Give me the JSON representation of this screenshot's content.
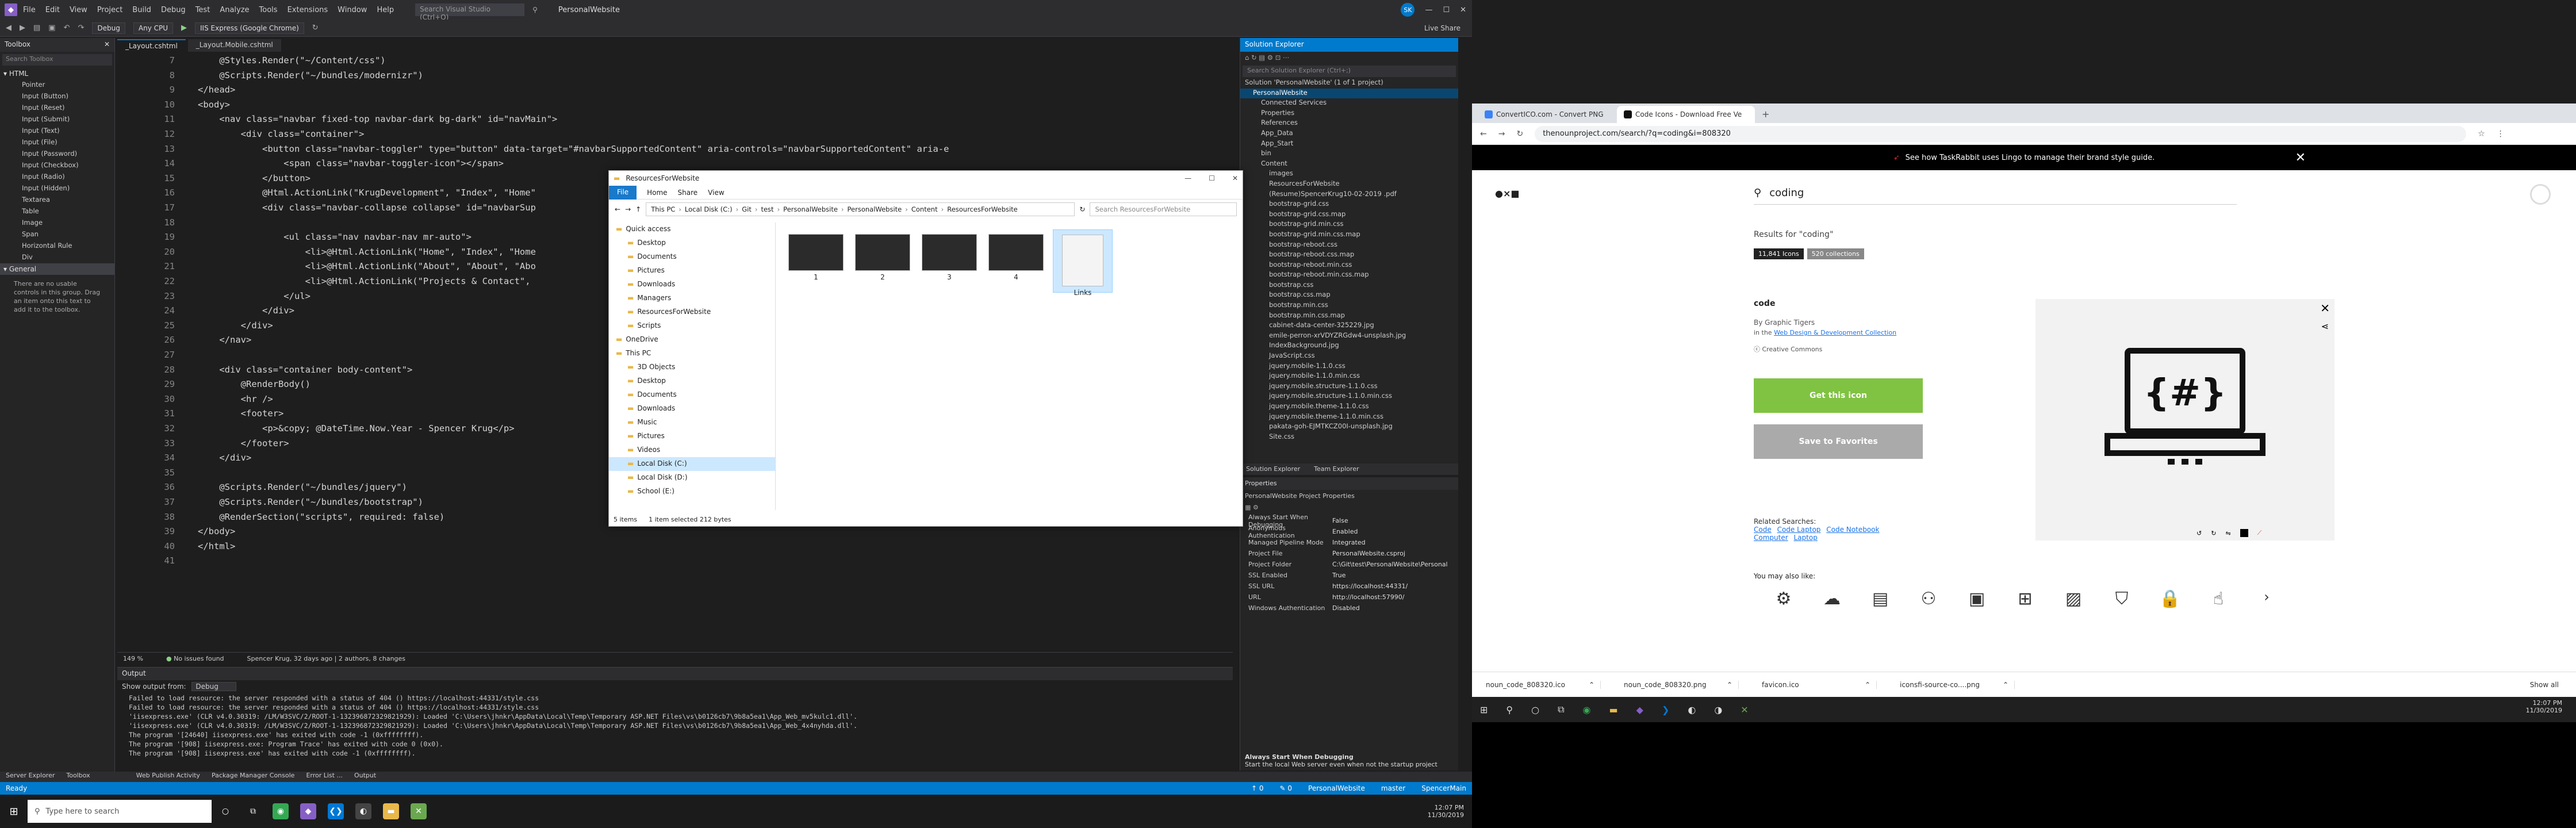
{
  "vs": {
    "menu": [
      "File",
      "Edit",
      "View",
      "Project",
      "Build",
      "Debug",
      "Test",
      "Analyze",
      "Tools",
      "Extensions",
      "Window",
      "Help"
    ],
    "search_placeholder": "Search Visual Studio (Ctrl+Q)",
    "project_name": "PersonalWebsite",
    "user_initials": "SK",
    "live_share": "Live Share",
    "toolbar": {
      "config": "Debug",
      "platform": "Any CPU",
      "run": "IIS Express (Google Chrome)"
    },
    "toolbox": {
      "title": "Toolbox",
      "search": "Search Toolbox",
      "html_group": "HTML",
      "items": [
        "Pointer",
        "Input (Button)",
        "Input (Reset)",
        "Input (Submit)",
        "Input (Text)",
        "Input (File)",
        "Input (Password)",
        "Input (Checkbox)",
        "Input (Radio)",
        "Input (Hidden)",
        "Textarea",
        "Table",
        "Image",
        "Span",
        "Horizontal Rule",
        "Div"
      ],
      "general_group": "General",
      "note": "There are no usable controls in this group. Drag an item onto this text to add it to the toolbox."
    },
    "tabs": [
      "_Layout.cshtml",
      "_Layout.Mobile.cshtml"
    ],
    "code_lines": [
      {
        "n": "7",
        "t": "    @Styles.Render(\"~/Content/css\")"
      },
      {
        "n": "8",
        "t": "    @Scripts.Render(\"~/bundles/modernizr\")"
      },
      {
        "n": "9",
        "t": "</head>"
      },
      {
        "n": "10",
        "t": "<body>"
      },
      {
        "n": "11",
        "t": "    <nav class=\"navbar fixed-top navbar-dark bg-dark\" id=\"navMain\">"
      },
      {
        "n": "12",
        "t": "        <div class=\"container\">"
      },
      {
        "n": "13",
        "t": "            <button class=\"navbar-toggler\" type=\"button\" data-target=\"#navbarSupportedContent\" aria-controls=\"navbarSupportedContent\" aria-e"
      },
      {
        "n": "14",
        "t": "                <span class=\"navbar-toggler-icon\"></span>"
      },
      {
        "n": "15",
        "t": "            </button>"
      },
      {
        "n": "16",
        "t": "            @Html.ActionLink(\"KrugDevelopment\", \"Index\", \"Home\""
      },
      {
        "n": "17",
        "t": "            <div class=\"navbar-collapse collapse\" id=\"navbarSup"
      },
      {
        "n": "18",
        "t": ""
      },
      {
        "n": "19",
        "t": "                <ul class=\"nav navbar-nav mr-auto\">"
      },
      {
        "n": "20",
        "t": "                    <li>@Html.ActionLink(\"Home\", \"Index\", \"Home"
      },
      {
        "n": "21",
        "t": "                    <li>@Html.ActionLink(\"About\", \"About\", \"Abo"
      },
      {
        "n": "22",
        "t": "                    <li>@Html.ActionLink(\"Projects & Contact\","
      },
      {
        "n": "23",
        "t": "                </ul>"
      },
      {
        "n": "24",
        "t": "            </div>"
      },
      {
        "n": "25",
        "t": "        </div>"
      },
      {
        "n": "26",
        "t": "    </nav>"
      },
      {
        "n": "27",
        "t": ""
      },
      {
        "n": "28",
        "t": "    <div class=\"container body-content\">"
      },
      {
        "n": "29",
        "t": "        @RenderBody()"
      },
      {
        "n": "30",
        "t": "        <hr />"
      },
      {
        "n": "31",
        "t": "        <footer>"
      },
      {
        "n": "32",
        "t": "            <p>&copy; @DateTime.Now.Year - Spencer Krug</p>"
      },
      {
        "n": "33",
        "t": "        </footer>"
      },
      {
        "n": "34",
        "t": "    </div>"
      },
      {
        "n": "35",
        "t": ""
      },
      {
        "n": "36",
        "t": "    @Scripts.Render(\"~/bundles/jquery\")"
      },
      {
        "n": "37",
        "t": "    @Scripts.Render(\"~/bundles/bootstrap\")"
      },
      {
        "n": "38",
        "t": "    @RenderSection(\"scripts\", required: false)"
      },
      {
        "n": "39",
        "t": "</body>"
      },
      {
        "n": "40",
        "t": "</html>"
      },
      {
        "n": "41",
        "t": ""
      }
    ],
    "zoom": "149 %",
    "issues": "No issues found",
    "git_info": "Spencer Krug, 32 days ago | 2 authors, 8 changes",
    "output": {
      "title": "Output",
      "show_from_label": "Show output from:",
      "show_from_value": "Debug",
      "lines": [
        "Failed to load resource: the server responded with a status of 404 () https://localhost:44331/style.css",
        "Failed to load resource: the server responded with a status of 404 () https://localhost:44331/style.css",
        "'iisexpress.exe' (CLR v4.0.30319: /LM/W3SVC/2/ROOT-1-132396872329821929): Loaded 'C:\\Users\\jhnkr\\AppData\\Local\\Temp\\Temporary ASP.NET Files\\vs\\b0126cb7\\9b8a5ea1\\App_Web_mv5kulc1.dll'.",
        "'iisexpress.exe' (CLR v4.0.30319: /LM/W3SVC/2/ROOT-1-132396872329821929): Loaded 'C:\\Users\\jhnkr\\AppData\\Local\\Temp\\Temporary ASP.NET Files\\vs\\b0126cb7\\9b8a5ea1\\App_Web_4x4nyhda.dll'.",
        "The program '[24640] iisexpress.exe' has exited with code -1 (0xffffffff).",
        "The program '[908] iisexpress.exe: Program Trace' has exited with code 0 (0x0).",
        "The program '[908] iisexpress.exe' has exited with code -1 (0xffffffff)."
      ]
    },
    "bottom_tabs": [
      "Web Publish Activity",
      "Package Manager Console",
      "Error List ...",
      "Output"
    ],
    "left_bottom_tabs": [
      "Server Explorer",
      "Toolbox"
    ],
    "status": {
      "left": "Ready",
      "items": [
        "↑ 0",
        "✎ 0",
        "PersonalWebsite",
        "master",
        "SpencerMain"
      ]
    },
    "solution": {
      "title": "Solution Explorer",
      "search": "Search Solution Explorer (Ctrl+;)",
      "nodes": [
        {
          "t": "Solution 'PersonalWebsite' (1 of 1 project)",
          "d": 0
        },
        {
          "t": "PersonalWebsite",
          "d": 1,
          "sel": true
        },
        {
          "t": "Connected Services",
          "d": 2
        },
        {
          "t": "Properties",
          "d": 2
        },
        {
          "t": "References",
          "d": 2
        },
        {
          "t": "App_Data",
          "d": 2
        },
        {
          "t": "App_Start",
          "d": 2
        },
        {
          "t": "bin",
          "d": 2
        },
        {
          "t": "Content",
          "d": 2
        },
        {
          "t": "images",
          "d": 3
        },
        {
          "t": "ResourcesForWebsite",
          "d": 3
        },
        {
          "t": "(Resume)SpencerKrug10-02-2019 .pdf",
          "d": 3
        },
        {
          "t": "bootstrap-grid.css",
          "d": 3
        },
        {
          "t": "bootstrap-grid.css.map",
          "d": 3
        },
        {
          "t": "bootstrap-grid.min.css",
          "d": 3
        },
        {
          "t": "bootstrap-grid.min.css.map",
          "d": 3
        },
        {
          "t": "bootstrap-reboot.css",
          "d": 3
        },
        {
          "t": "bootstrap-reboot.css.map",
          "d": 3
        },
        {
          "t": "bootstrap-reboot.min.css",
          "d": 3
        },
        {
          "t": "bootstrap-reboot.min.css.map",
          "d": 3
        },
        {
          "t": "bootstrap.css",
          "d": 3
        },
        {
          "t": "bootstrap.css.map",
          "d": 3
        },
        {
          "t": "bootstrap.min.css",
          "d": 3
        },
        {
          "t": "bootstrap.min.css.map",
          "d": 3
        },
        {
          "t": "cabinet-data-center-325229.jpg",
          "d": 3
        },
        {
          "t": "emile-perron-xrVDYZRGdw4-unsplash.jpg",
          "d": 3
        },
        {
          "t": "IndexBackground.jpg",
          "d": 3
        },
        {
          "t": "JavaScript.css",
          "d": 3
        },
        {
          "t": "jquery.mobile-1.1.0.css",
          "d": 3
        },
        {
          "t": "jquery.mobile-1.1.0.min.css",
          "d": 3
        },
        {
          "t": "jquery.mobile.structure-1.1.0.css",
          "d": 3
        },
        {
          "t": "jquery.mobile.structure-1.1.0.min.css",
          "d": 3
        },
        {
          "t": "jquery.mobile.theme-1.1.0.css",
          "d": 3
        },
        {
          "t": "jquery.mobile.theme-1.1.0.min.css",
          "d": 3
        },
        {
          "t": "pakata-goh-EJMTKCZ00I-unsplash.jpg",
          "d": 3
        },
        {
          "t": "Site.css",
          "d": 3
        }
      ],
      "bottom_tabs": [
        "Solution Explorer",
        "Team Explorer"
      ]
    },
    "properties": {
      "title": "Properties",
      "subtitle": "PersonalWebsite  Project Properties",
      "rows": [
        {
          "k": "Always Start When Debugging",
          "v": "False"
        },
        {
          "k": "Anonymous Authentication",
          "v": "Enabled"
        },
        {
          "k": "Managed Pipeline Mode",
          "v": "Integrated"
        },
        {
          "k": "Project File",
          "v": "PersonalWebsite.csproj"
        },
        {
          "k": "Project Folder",
          "v": "C:\\Git\\test\\PersonalWebsite\\Personal"
        },
        {
          "k": "SSL Enabled",
          "v": "True"
        },
        {
          "k": "SSL URL",
          "v": "https://localhost:44331/"
        },
        {
          "k": "URL",
          "v": "http://localhost:57990/"
        },
        {
          "k": "Windows Authentication",
          "v": "Disabled"
        }
      ],
      "desc_title": "Always Start When Debugging",
      "desc_text": "Start the local Web server even when not the startup project"
    }
  },
  "explorer": {
    "title": "ResourcesForWebsite",
    "ribbon": [
      "File",
      "Home",
      "Share",
      "View"
    ],
    "path": [
      "This PC",
      "Local Disk (C:)",
      "Git",
      "test",
      "PersonalWebsite",
      "PersonalWebsite",
      "Content",
      "ResourcesForWebsite"
    ],
    "search_placeholder": "Search ResourcesForWebsite",
    "nav": [
      {
        "t": "Quick access",
        "d": 0
      },
      {
        "t": "Desktop",
        "d": 1
      },
      {
        "t": "Documents",
        "d": 1
      },
      {
        "t": "Pictures",
        "d": 1
      },
      {
        "t": "Downloads",
        "d": 1
      },
      {
        "t": "Managers",
        "d": 1
      },
      {
        "t": "ResourcesForWebsite",
        "d": 1
      },
      {
        "t": "Scripts",
        "d": 1
      },
      {
        "t": "OneDrive",
        "d": 0
      },
      {
        "t": "This PC",
        "d": 0
      },
      {
        "t": "3D Objects",
        "d": 1
      },
      {
        "t": "Desktop",
        "d": 1
      },
      {
        "t": "Documents",
        "d": 1
      },
      {
        "t": "Downloads",
        "d": 1
      },
      {
        "t": "Music",
        "d": 1
      },
      {
        "t": "Pictures",
        "d": 1
      },
      {
        "t": "Videos",
        "d": 1
      },
      {
        "t": "Local Disk (C:)",
        "d": 1,
        "sel": true
      },
      {
        "t": "Local Disk (D:)",
        "d": 1
      },
      {
        "t": "School (E:)",
        "d": 1
      }
    ],
    "files": [
      "1",
      "2",
      "3",
      "4",
      "Links"
    ],
    "status": [
      "5 items",
      "1 item selected  212 bytes"
    ]
  },
  "chrome": {
    "tabs": [
      {
        "t": "ConvertICO.com - Convert PNG",
        "color": "#3b82f6"
      },
      {
        "t": "Code Icons - Download Free Ve",
        "color": "#111111",
        "active": true
      }
    ],
    "url": "thenounproject.com/search/?q=coding&i=808320",
    "banner": "See how TaskRabbit uses Lingo to manage their brand style guide.",
    "search_query": "coding",
    "results_label": "Results for \"coding\"",
    "badge_icons": "11,841 Icons",
    "badge_collections": "520 collections",
    "icon_title": "code",
    "by": "By Graphic Tigers",
    "in_prefix": "in the",
    "in_collection": "Web Design & Development Collection",
    "license": "Creative Commons",
    "get_button": "Get this icon",
    "fav_button": "Save to Favorites",
    "related_label": "Related Searches:",
    "related": [
      "Code",
      "Code Laptop",
      "Code Notebook",
      "Computer",
      "Laptop"
    ],
    "preview_icon_text": "{#}",
    "you_may_like": "You may also like:",
    "downloads": [
      "noun_code_808320.ico",
      "noun_code_808320.png",
      "favicon.ico",
      "iconsfi-source-co....png"
    ],
    "show_all": "Show all",
    "clock": {
      "time": "12:07 PM",
      "date": "11/30/2019"
    }
  },
  "taskbar": {
    "search_placeholder": "Type here to search",
    "clock": {
      "time": "12:07 PM",
      "date": "11/30/2019"
    }
  }
}
